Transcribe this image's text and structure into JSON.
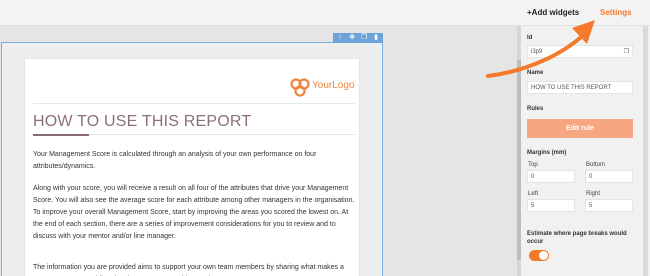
{
  "topbar": {
    "add_widgets": "+Add widgets",
    "settings": "Settings"
  },
  "toolbar": {
    "icons": [
      "arrow-up-icon",
      "move-icon",
      "copy-icon",
      "delete-icon"
    ]
  },
  "report": {
    "logo_text": "YourLogo",
    "title": "HOW TO USE THIS REPORT",
    "paragraphs": [
      "Your Management Score is calculated through an analysis of your own performance on four attributes/dynamics.",
      "Along with your score, you will receive a result on all four of the attributes that drive your Management Score. You will also see the average score for each attribute among other managers in the organisation. To improve your overall Management Score, start by improving the areas you scored the lowest on. At the end of each section, there are a series of improvement considerations for you to review and to discuss with your mentor and/or line manager.",
      "The information you are provided aims to support your own team members by sharing what makes a great manager, providing development opportunities, and more."
    ]
  },
  "panel": {
    "id_label": "Id",
    "id_value": "i3p9",
    "name_label": "Name",
    "name_value": "HOW TO USE THIS REPORT",
    "rules_label": "Rules",
    "edit_rule": "Edit rule",
    "margins_label": "Margins (mm)",
    "top_label": "Top",
    "top_value": "0",
    "bottom_label": "Bottom",
    "bottom_value": "0",
    "left_label": "Left",
    "left_value": "5",
    "right_label": "Right",
    "right_value": "5",
    "estimate_label": "Estimate where page breaks would occur",
    "estimate_on": true
  },
  "colors": {
    "accent": "#f47a2b",
    "title": "#8c6e7a",
    "selection": "#6da3d8"
  }
}
